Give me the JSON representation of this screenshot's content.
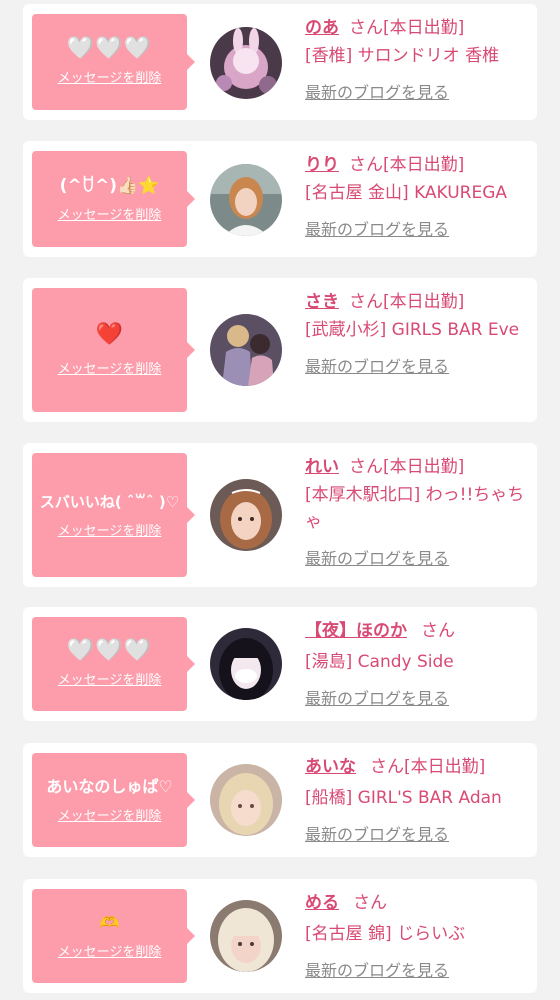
{
  "delete_label": "メッセージを削除",
  "blog_label": "最新のブログを見る",
  "san_label": "さん",
  "colors": {
    "bubble": "#fd9cab",
    "name": "#d84a74",
    "link_gray": "#8a8a8a",
    "background": "#f2f2f2"
  },
  "messages": [
    {
      "message": "🤍🤍🤍",
      "name": "のあ",
      "duty": "[本日出勤]",
      "shop": "[香椎] サロンドリオ 香椎"
    },
    {
      "message": "(^ꇴ^)👍🏻⭐",
      "name": "りり",
      "duty": "[本日出勤]",
      "shop": "[名古屋 金山] KAKUREGA"
    },
    {
      "message": "❤️",
      "name": "さき",
      "duty": "[本日出勤]",
      "shop": "[武蔵小杉] GIRLS BAR Eve"
    },
    {
      "message": "スバいいね( ˆ꒳ˆ )♡",
      "name": "れい",
      "duty": "[本日出勤]",
      "shop": "[本厚木駅北口] わっ!!ちゃちゃ"
    },
    {
      "message": "🤍🤍🤍",
      "name": "【夜】ほのか",
      "duty": "",
      "shop": "[湯島] Candy Side"
    },
    {
      "message": "あいなのしゅぱ♡",
      "name": "あいな",
      "duty": "[本日出勤]",
      "shop": "[船橋] GIRL'S BAR Adan"
    },
    {
      "message": "🫶",
      "name": "める",
      "duty": "",
      "shop": "[名古屋 錦] じらいぶ"
    }
  ]
}
